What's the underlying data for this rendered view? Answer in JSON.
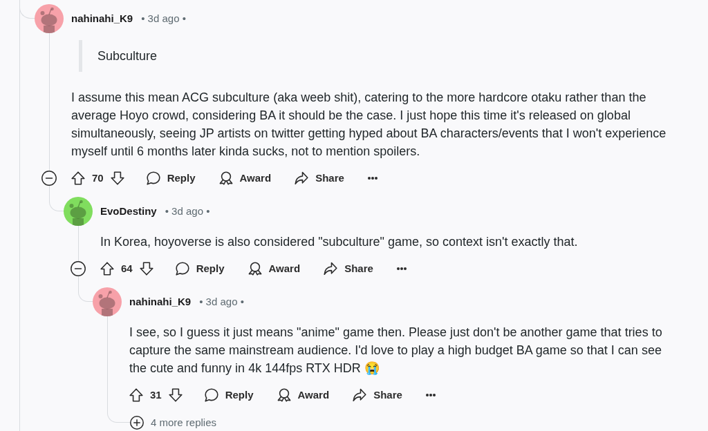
{
  "comments": [
    {
      "username": "nahinahi_K9",
      "meta": "• 3d ago •",
      "color": "#f7a1a9",
      "quote": "Subculture",
      "body": "I assume this mean ACG subculture (aka weeb shit), catering to the more hardcore otaku rather than the average Hoyo crowd, considering BA it should be the case. I just hope this time it's released on global simultaneously, seeing JP artists on twitter getting hyped about BA characters/events that I won't experience myself until 6 months later kinda sucks, not to mention spoilers.",
      "votes": "70",
      "actions": [
        {
          "kind": "reply",
          "label": "Reply"
        },
        {
          "kind": "award",
          "label": "Award"
        },
        {
          "kind": "share",
          "label": "Share"
        }
      ],
      "children": [
        {
          "username": "EvoDestiny",
          "meta": "• 3d ago •",
          "color": "#80dd5e",
          "body": "In Korea, hoyoverse is also considered \"subculture\" game, so context isn't exactly that.",
          "votes": "64",
          "actions": [
            {
              "kind": "reply",
              "label": "Reply"
            },
            {
              "kind": "award",
              "label": "Award"
            },
            {
              "kind": "share",
              "label": "Share"
            }
          ],
          "children": [
            {
              "username": "nahinahi_K9",
              "meta": "• 3d ago •",
              "color": "#f7a1a9",
              "body": "I see, so I guess it just means \"anime\" game then. Please just don't be another game that tries to capture the same mainstream audience. I'd love to play a high budget BA game so that I can see the cute and funny in 4k 144fps RTX HDR 😭",
              "votes": "31",
              "actions": [
                {
                  "kind": "reply",
                  "label": "Reply"
                },
                {
                  "kind": "award",
                  "label": "Award"
                },
                {
                  "kind": "share",
                  "label": "Share"
                }
              ],
              "more_replies": "4 more replies"
            }
          ]
        }
      ]
    }
  ]
}
